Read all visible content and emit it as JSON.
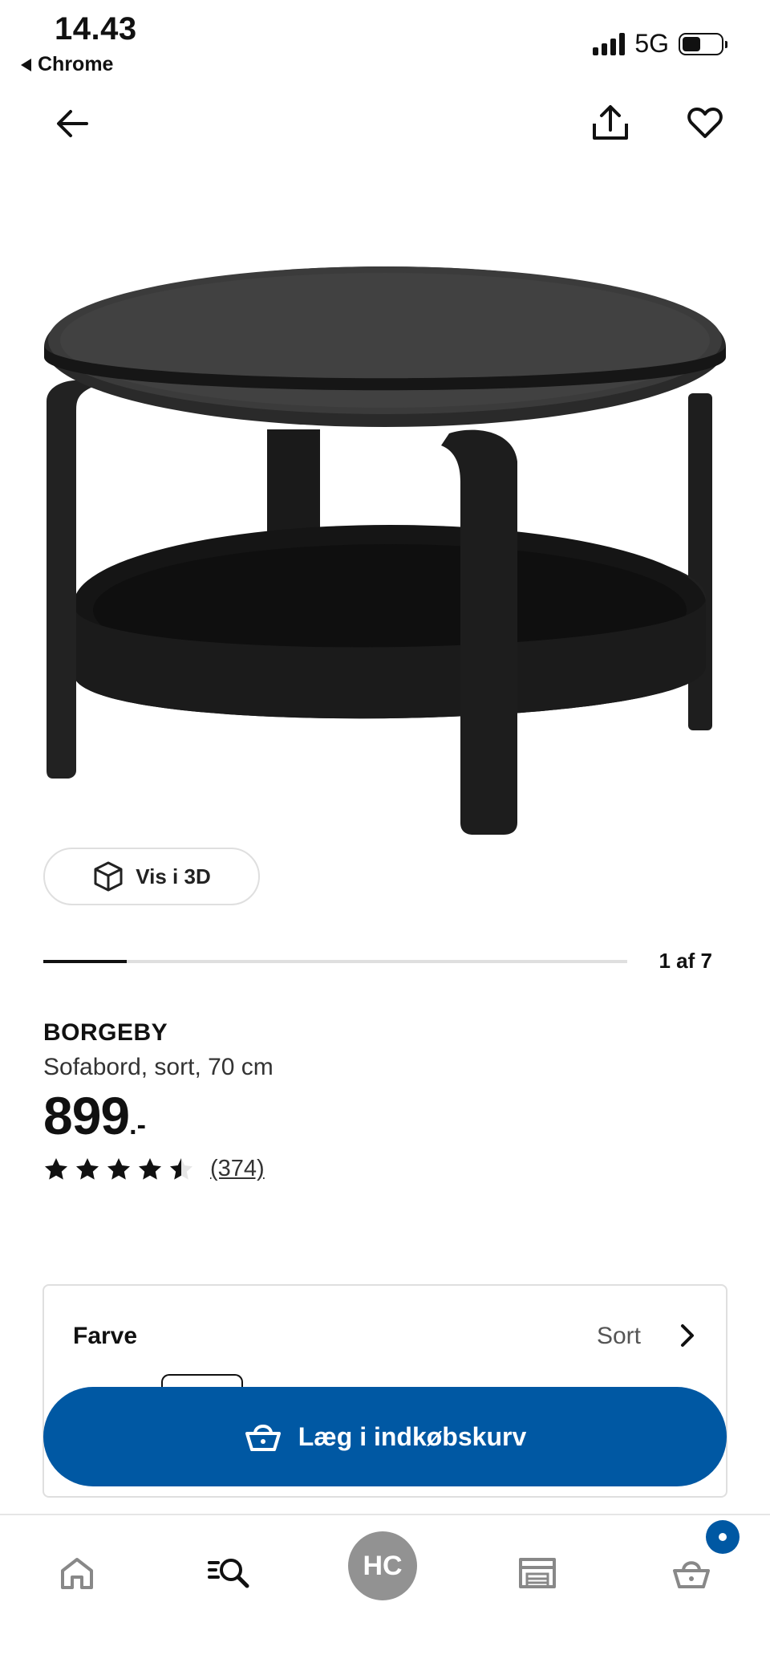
{
  "status_bar": {
    "time": "14.43",
    "back_app": "Chrome",
    "network": "5G"
  },
  "header": {
    "back_icon": "arrow-left-icon",
    "share_icon": "share-icon",
    "favorite_icon": "heart-icon"
  },
  "product": {
    "view_3d_label": "Vis i 3D",
    "gallery_counter": "1 af 7",
    "gallery_position": 1,
    "gallery_total": 7,
    "brand": "BORGEBY",
    "description": "Sofabord, sort, 70 cm",
    "price": "899",
    "price_suffix": ".-",
    "rating": 4.5,
    "reviews": "(374)"
  },
  "color_selector": {
    "label": "Farve",
    "value": "Sort"
  },
  "cart_button": {
    "label": "Læg i indkøbskurv"
  },
  "bottom_nav": {
    "profile_initials": "HC",
    "items": [
      "home-icon",
      "search-icon",
      "profile-avatar",
      "store-icon",
      "cart-icon"
    ]
  },
  "colors": {
    "brand_blue": "#0058a3",
    "avatar_gray": "#929292"
  }
}
